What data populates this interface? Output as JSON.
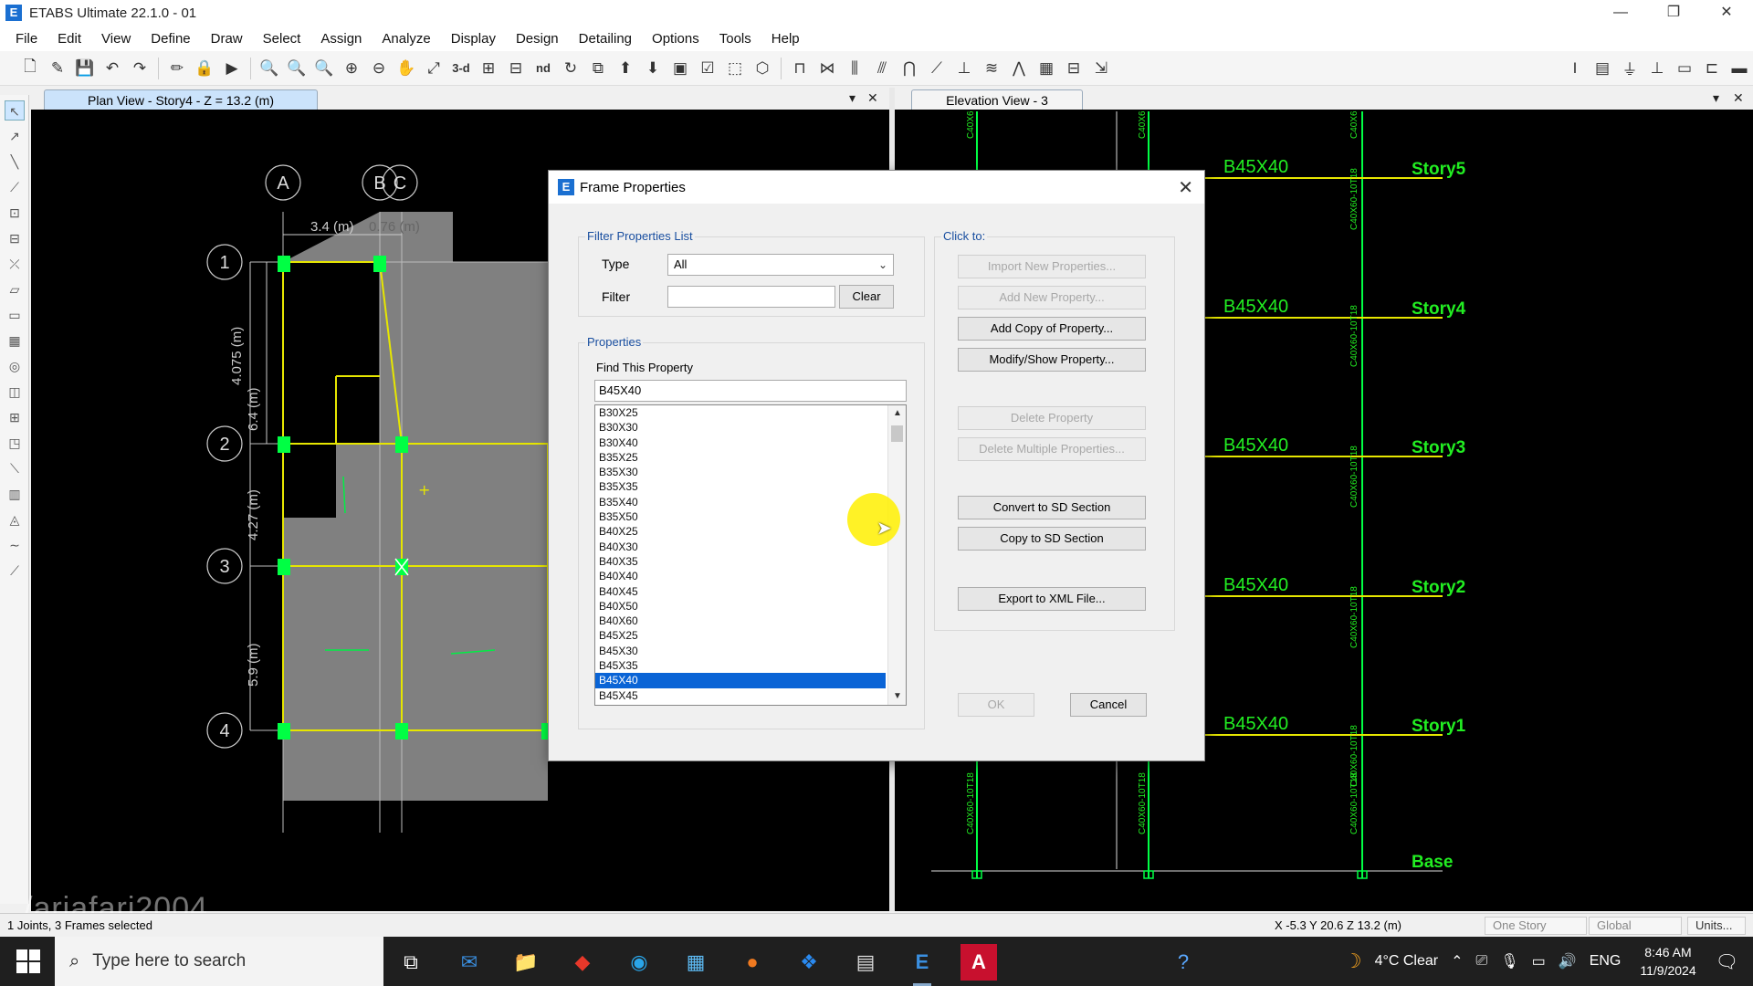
{
  "window": {
    "title": "ETABS Ultimate 22.1.0 - 01",
    "app_icon": "E",
    "controls": [
      "—",
      "❐",
      "✕"
    ]
  },
  "menu": [
    "File",
    "Edit",
    "View",
    "Define",
    "Draw",
    "Select",
    "Assign",
    "Analyze",
    "Display",
    "Design",
    "Detailing",
    "Options",
    "Tools",
    "Help"
  ],
  "toolbar": {
    "view_3d": "3-d",
    "view_nd": "nd"
  },
  "left_pane": {
    "tab_title": "Plan View - Story4 - Z = 13.2 (m)",
    "grid_letters": [
      "A",
      "B",
      "C"
    ],
    "grid_numbers": [
      "1",
      "2",
      "3",
      "4"
    ],
    "dims": {
      "ab": "3.4 (m)",
      "bc": "0.76 (m)",
      "v1": "4.075 (m)",
      "v2": "6.4 (m)",
      "v3": "4.27 (m)",
      "v4": "5.9 (m)"
    }
  },
  "right_pane": {
    "tab_title": "Elevation View - 3",
    "beam_label": "B45X40",
    "stories": [
      "Story5",
      "Story4",
      "Story3",
      "Story2",
      "Story1",
      "Base"
    ],
    "column_label": "C40X60-10T18",
    "column_label_short": "C40X6"
  },
  "dialog": {
    "title": "Frame Properties",
    "filter_group": "Filter Properties List",
    "type_label": "Type",
    "type_value": "All",
    "filter_label": "Filter",
    "filter_value": "",
    "clear_button": "Clear",
    "properties_group": "Properties",
    "find_label": "Find This Property",
    "find_value": "B45X40",
    "list": [
      "B30X25",
      "B30X30",
      "B30X40",
      "B35X25",
      "B35X30",
      "B35X35",
      "B35X40",
      "B35X50",
      "B40X25",
      "B40X30",
      "B40X35",
      "B40X40",
      "B40X45",
      "B40X50",
      "B40X60",
      "B45X25",
      "B45X30",
      "B45X35",
      "B45X40",
      "B45X45"
    ],
    "selected": "B45X40",
    "click_to_label": "Click to:",
    "buttons": {
      "import_new": "Import New Properties...",
      "add_new": "Add New Property...",
      "add_copy": "Add Copy of Property...",
      "modify_show": "Modify/Show Property...",
      "delete": "Delete Property",
      "delete_multiple": "Delete Multiple Properties...",
      "convert_sd": "Convert to SD Section",
      "copy_sd": "Copy to SD Section",
      "export_xml": "Export to XML File...",
      "ok": "OK",
      "cancel": "Cancel"
    }
  },
  "status": {
    "selection": "1 Joints, 3 Frames selected",
    "coords": "X -5.3  Y 20.6  Z 13.2 (m)",
    "story_mode": "One Story",
    "coord_system": "Global",
    "units": "Units..."
  },
  "watermark": "/ariafari2004",
  "taskbar": {
    "search_placeholder": "Type here to search",
    "weather": "4°C  Clear",
    "language": "ENG",
    "time": "8:46 AM",
    "date": "11/9/2024"
  },
  "colors": {
    "accent": "#0a64d6",
    "drawing_green": "#00ff44",
    "drawing_yellow": "#e6e600",
    "slab_gray": "#808080",
    "label_green": "#22ee22"
  }
}
